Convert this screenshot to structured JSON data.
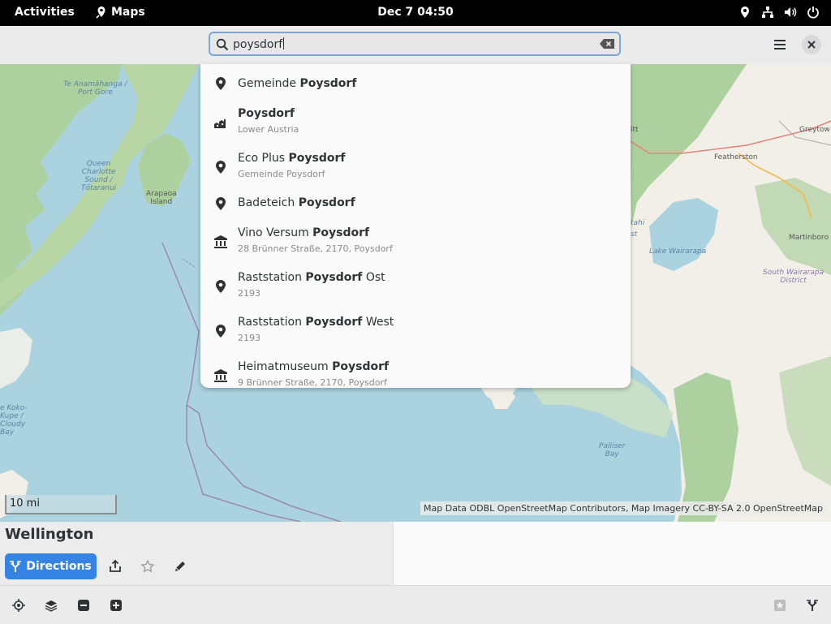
{
  "topbar": {
    "activities": "Activities",
    "app_name": "Maps",
    "clock": "Dec 7  04:50"
  },
  "search": {
    "value": "poysdorf"
  },
  "results": [
    {
      "prefix": "Gemeinde ",
      "match": "Poysdorf",
      "suffix": "",
      "subtitle": "",
      "icon": "location-pin-icon"
    },
    {
      "prefix": "",
      "match": "Poysdorf",
      "suffix": "",
      "subtitle": "Lower Austria",
      "icon": "town-icon"
    },
    {
      "prefix": "Eco Plus ",
      "match": "Poysdorf",
      "suffix": "",
      "subtitle": "Gemeinde Poysdorf",
      "icon": "location-pin-icon"
    },
    {
      "prefix": "Badeteich ",
      "match": "Poysdorf",
      "suffix": "",
      "subtitle": "",
      "icon": "location-pin-icon"
    },
    {
      "prefix": "Vino Versum ",
      "match": "Poysdorf",
      "suffix": "",
      "subtitle": "28 Brünner Straße, 2170, Poysdorf",
      "icon": "museum-icon"
    },
    {
      "prefix": "Raststation ",
      "match": "Poysdorf",
      "suffix": " Ost",
      "subtitle": "2193",
      "icon": "location-pin-icon"
    },
    {
      "prefix": "Raststation ",
      "match": "Poysdorf",
      "suffix": " West",
      "subtitle": "2193",
      "icon": "location-pin-icon"
    },
    {
      "prefix": "Heimatmuseum ",
      "match": "Poysdorf",
      "suffix": "",
      "subtitle": "9 Brünner Straße, 2170, Poysdorf",
      "icon": "museum-icon"
    }
  ],
  "map": {
    "labels": {
      "te_anamahanga_1": "Te Anamāhanga /",
      "te_anamahanga_2": "Port Gore",
      "queen_1": "Queen",
      "queen_2": "Charlotte",
      "queen_3": "Sound /",
      "queen_4": "Tōtaranui",
      "arapaoa_1": "Arapaoa",
      "arapaoa_2": "Island",
      "greytown": "Greytow",
      "featherston": "Featherston",
      "martinborough": "Martinborо",
      "lake": "Lake Wairarapa",
      "south_wairarapa_1": "South Wairarapa",
      "south_wairarapa_2": "District",
      "palliser_1": "Palliser",
      "palliser_2": "Bay",
      "koko_1": "e Koko-",
      "koko_2": "Kupe /",
      "koko_3": "Cloudy",
      "koko_4": "Bay",
      "itt": "itt",
      "tahi": "tahi",
      "st": "st"
    },
    "scale": "10 mi",
    "attribution": "Map Data ODBL OpenStreetMap Contributors, Map Imagery CC-BY-SA 2.0 OpenStreetMap"
  },
  "place": {
    "name": "Wellington",
    "directions_label": "Directions"
  },
  "colors": {
    "accent": "#3584e4",
    "water": "#aad3df",
    "land": "#f2efe9",
    "forest": "#add19e"
  }
}
